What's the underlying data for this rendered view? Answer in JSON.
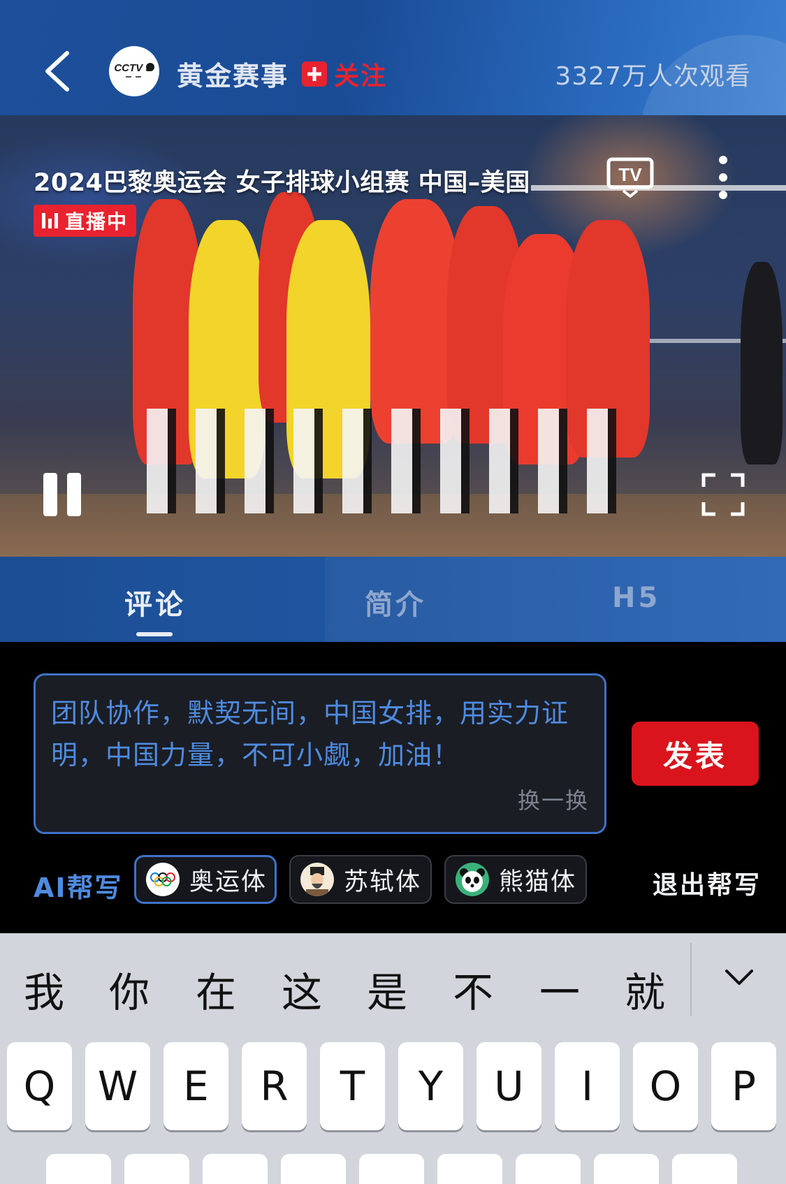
{
  "header": {
    "channel_name": "黄金赛事",
    "follow_label": "关注",
    "view_count": "3327万人次观看",
    "logo_text": "CCTV 5"
  },
  "video": {
    "title": "2024巴黎奥运会 女子排球小组赛 中国–美国",
    "live_label": "直播中",
    "icons": [
      "tv-cast-icon",
      "more-vertical-icon",
      "pause-icon",
      "fullscreen-icon",
      "back-chevron-icon"
    ]
  },
  "tabs": [
    {
      "label": "评论",
      "active": true
    },
    {
      "label": "简介",
      "active": false
    },
    {
      "label": "H5",
      "active": false
    }
  ],
  "comment": {
    "text": "团队协作，默契无间，中国女排，用实力证明，中国力量，不可小觑，加油！",
    "refresh_label": "换一换",
    "publish_label": "发表"
  },
  "ai_write": {
    "label": "AI帮写",
    "styles": [
      {
        "label": "奥运体",
        "icon": "olympic-rings-icon",
        "selected": true
      },
      {
        "label": "苏轼体",
        "icon": "su-shi-portrait-icon",
        "selected": false
      },
      {
        "label": "熊猫体",
        "icon": "panda-icon",
        "selected": false
      }
    ],
    "exit_label": "退出帮写"
  },
  "keyboard": {
    "candidates": [
      "我",
      "你",
      "在",
      "这",
      "是",
      "不",
      "一",
      "就"
    ],
    "row1": [
      "Q",
      "W",
      "E",
      "R",
      "T",
      "Y",
      "U",
      "I",
      "O",
      "P"
    ]
  },
  "colors": {
    "header_blue": "#1d4f9a",
    "accent_red": "#e8232f",
    "ai_blue": "#4f8be0",
    "publish_red": "#d9141c",
    "keyboard_bg": "#d2d5db"
  }
}
